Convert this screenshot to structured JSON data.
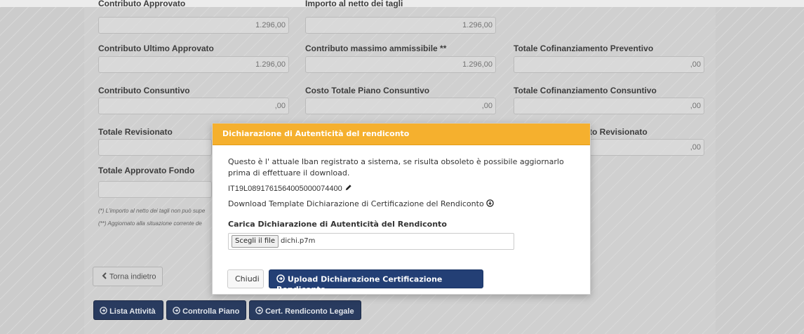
{
  "form": {
    "top_label_left": "Contributo Approvato",
    "top_label_mid": "Importo al netto dei tagli",
    "top_val_left": "1.296,00",
    "top_val_mid": "1.296,00",
    "row2": {
      "l1": "Contributo Ultimo Approvato",
      "v1": "1.296,00",
      "l2": "Contributo massimo ammissibile **",
      "v2": "1.296,00",
      "l3": "Totale Cofinanziamento Preventivo",
      "v3": ",00"
    },
    "row3": {
      "l1": "Contributo Consuntivo",
      "v1": ",00",
      "l2": "Costo Totale Piano Consuntivo",
      "v2": ",00",
      "l3": "Totale Cofinanziamento Consuntivo",
      "v3": ",00"
    },
    "row4": {
      "l1": "Totale Revisionato",
      "l3": "to Revisionato",
      "v3": ",00"
    },
    "row5": {
      "l1": "Totale Approvato Fondo"
    },
    "note1": "(*) L'importo al netto dei tagli non può supe",
    "note2": "(**) Aggiornato alla situazione corrente de"
  },
  "buttons": {
    "back": "Torna indietro",
    "activities": "Lista Attività",
    "check_plan": "Controlla Piano",
    "cert": "Cert. Rendiconto Legale"
  },
  "modal": {
    "title": "Dichiarazione di Autenticità del rendiconto",
    "line1": "Questo è l' attuale Iban registrato a sistema, se risulta obsoleto è possibile aggiornarlo",
    "line2": "prima di effettuare il download.",
    "iban": "IT19L0891761564005000074400",
    "download": "Download Template Dichiarazione di Certificazione del Rendiconto",
    "upload_label": "Carica Dichiarazione di Autenticità del Rendiconto",
    "file_button": "Scegli il file",
    "file_name": "dichi.p7m",
    "close": "Chiudi",
    "upload": "Upload Dichiarazione Certificazione Rendiconto"
  },
  "colors": {
    "header": "#f5b02e",
    "primary": "#233f75"
  },
  "icons": [
    "pencil-icon",
    "download-circle-icon",
    "chevron-left-icon",
    "arrow-circle-icon"
  ]
}
